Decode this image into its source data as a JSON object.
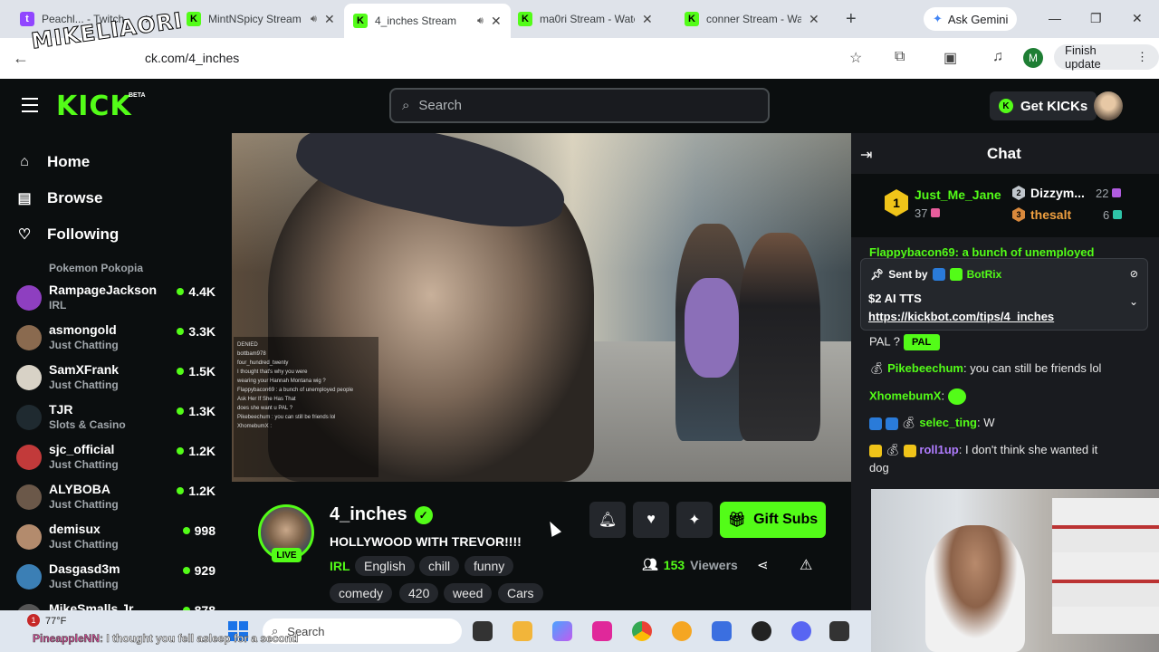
{
  "browser": {
    "tabs": [
      {
        "title": "Peachl... - Twitch",
        "icon": "twitch-icon",
        "audio": false,
        "active": false
      },
      {
        "title": "MintNSpicy Stream",
        "icon": "kick-icon",
        "audio": true,
        "active": false
      },
      {
        "title": "4_inches Stream",
        "icon": "kick-icon",
        "audio": true,
        "active": true
      },
      {
        "title": "ma0ri Stream - Watch",
        "icon": "kick-icon",
        "audio": false,
        "active": false
      },
      {
        "title": "conner Stream - Wat",
        "icon": "kick-icon",
        "audio": false,
        "active": false
      }
    ],
    "new_tab": "+",
    "gemini_label": "Ask Gemini",
    "url": "ck.com/4_inches",
    "profile_initial": "M",
    "finish_update_label": "Finish update"
  },
  "overlay": {
    "logo_text": "MIKELIAORI"
  },
  "header": {
    "logo": "KICK",
    "beta": "BETA",
    "search_placeholder": "Search",
    "get_kicks_label": "Get KICKs"
  },
  "sidebar": {
    "nav": [
      {
        "label": "Home",
        "icon": "home-icon"
      },
      {
        "label": "Browse",
        "icon": "browse-icon"
      },
      {
        "label": "Following",
        "icon": "heart-icon"
      }
    ],
    "partial_top_category": "Pokemon Pokopia",
    "channels": [
      {
        "name": "RampageJackson",
        "category": "IRL",
        "viewers": "4.4K",
        "avatar_color": "#8e3fc0"
      },
      {
        "name": "asmongold",
        "category": "Just Chatting",
        "viewers": "3.3K",
        "avatar_color": "#8a6a4f"
      },
      {
        "name": "SamXFrank",
        "category": "Just Chatting",
        "viewers": "1.5K",
        "avatar_color": "#d8d2c6"
      },
      {
        "name": "TJR",
        "category": "Slots & Casino",
        "viewers": "1.3K",
        "avatar_color": "#1f2a30"
      },
      {
        "name": "sjc_official",
        "category": "Just Chatting",
        "viewers": "1.2K",
        "avatar_color": "#c23a3a"
      },
      {
        "name": "ALYBOBA",
        "category": "Just Chatting",
        "viewers": "1.2K",
        "avatar_color": "#6b5849"
      },
      {
        "name": "demisux",
        "category": "Just Chatting",
        "viewers": "998",
        "avatar_color": "#b38b6d"
      },
      {
        "name": "Dasgasd3m",
        "category": "Just Chatting",
        "viewers": "929",
        "avatar_color": "#3b7fb5"
      },
      {
        "name": "MikeSmalls Jr",
        "category": "",
        "viewers": "878",
        "avatar_color": "#555"
      }
    ]
  },
  "stream": {
    "channel": "4_inches",
    "live_label": "LIVE",
    "title": "HOLLYWOOD WITH TREVOR!!!!",
    "category": "IRL",
    "tags_row1": [
      "English",
      "chill",
      "funny"
    ],
    "tags_row2": [
      "comedy",
      "420",
      "weed",
      "Cars"
    ],
    "gift_subs_label": "Gift Subs",
    "viewers": "153",
    "viewers_label": "Viewers",
    "video_chat_overlay": [
      "DENIED",
      "bottbam978",
      "four_hundred_twenty",
      "I thought that's why you were",
      "wearing your Hannah Montana wig ?",
      "Flappybacon69 : a bunch of unemployed people",
      "Ask Her If She Has That",
      "does she want u PAL ?",
      "Pikebeechum : you can still be friends lol",
      "XhomebumX :"
    ]
  },
  "chat": {
    "title": "Chat",
    "leaderboard": [
      {
        "rank": "1",
        "name": "Just_Me_Jane",
        "count": "37",
        "gift_color": "#e85d9c"
      },
      {
        "rank": "2",
        "name": "Dizzym...",
        "count": "22",
        "gift_color": "#b05ce0"
      },
      {
        "rank": "3",
        "name": "thesalt",
        "count": "6",
        "gift_color": "#2ec4a8"
      }
    ],
    "pinned": {
      "sent_by": "Sent by",
      "bot": "BotRix",
      "message": "$2 AI TTS",
      "link": "https://kickbot.com/tips/4_inches"
    },
    "partial_message": "Flappybacon69: a bunch of unemployed",
    "messages": [
      {
        "user": "",
        "text": "PAL ?",
        "user_color": "#ffffff",
        "emote": "PAL"
      },
      {
        "user": "Pikebeechum",
        "text": "you can still be friends lol",
        "user_color": "#53fc18"
      },
      {
        "user": "XhomebumX",
        "text": "",
        "user_color": "#53fc18"
      },
      {
        "user": "selec_ting",
        "text": "W",
        "user_color": "#53fc18"
      },
      {
        "user": "roll1up",
        "text": "I don't think she wanted it",
        "user_color": "#b07cff"
      },
      {
        "user": "",
        "text": "dog",
        "user_color": "#ffffff"
      }
    ]
  },
  "taskbar": {
    "notification_count": "1",
    "weather": "77°F",
    "search_label": "Search",
    "overlay_chat_user": "PineappleNN",
    "overlay_chat_text": ": I thought you fell asleep for a second"
  },
  "colors": {
    "accent": "#53fc18",
    "bg": "#0b0e0f",
    "panel": "#191b1f"
  }
}
